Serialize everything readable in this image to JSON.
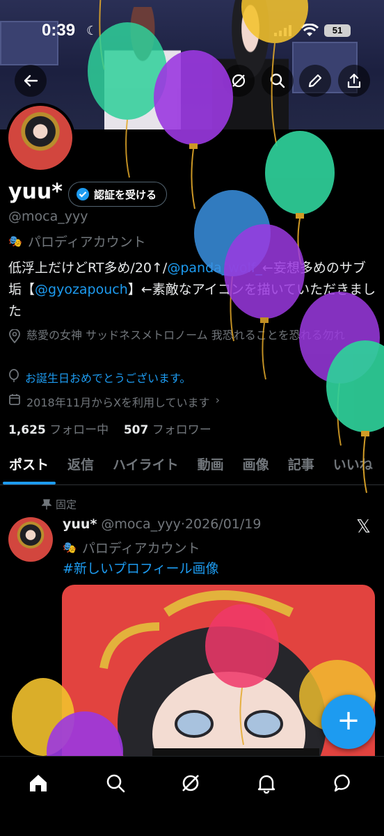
{
  "status_bar": {
    "time": "0:39",
    "battery": "51"
  },
  "profile": {
    "name": "yuu*",
    "verify_button": "認証を受ける",
    "handle": "@moca_yyy",
    "parody_label": "パロディアカウント",
    "bio": {
      "part1": "低浮上だけどRT多め/20↑/",
      "link1": "@panda_wolf_",
      "part2": "←妄想多めのサブ垢【",
      "link2": "@gyozapouch",
      "part3": "】←素敵なアイコンを描いていただきました"
    },
    "location": "慈愛の女神 サッドネスメトロノーム 我恐れることを恐れる勿れ",
    "birthday": "お誕生日おめでとうございます。",
    "joined": "2018年11月からXを利用しています",
    "following_count": "1,625",
    "following_label": "フォロー中",
    "followers_count": "507",
    "followers_label": "フォロワー"
  },
  "tabs": [
    {
      "label": "ポスト",
      "active": true
    },
    {
      "label": "返信"
    },
    {
      "label": "ハイライト"
    },
    {
      "label": "動画"
    },
    {
      "label": "画像"
    },
    {
      "label": "記事"
    },
    {
      "label": "いいね"
    }
  ],
  "pinned_post": {
    "pinned_label": "固定",
    "author_name": "yuu*",
    "author_handle": "@moca_yyy",
    "separator": "·",
    "date": "2026/01/19",
    "parody_label": "パロディアカウント",
    "hashtag": "#新しいプロフィール画像"
  },
  "icons": {
    "top": [
      "back-arrow-icon",
      "grok-icon",
      "search-icon",
      "edit-icon",
      "share-icon"
    ],
    "bottom_nav": [
      "home-icon",
      "search-icon",
      "grok-icon",
      "bell-icon",
      "messages-icon"
    ]
  },
  "colors": {
    "accent": "#1d9bf0",
    "background": "#000000",
    "text_primary": "#e7e9ea",
    "text_secondary": "#71767b"
  }
}
